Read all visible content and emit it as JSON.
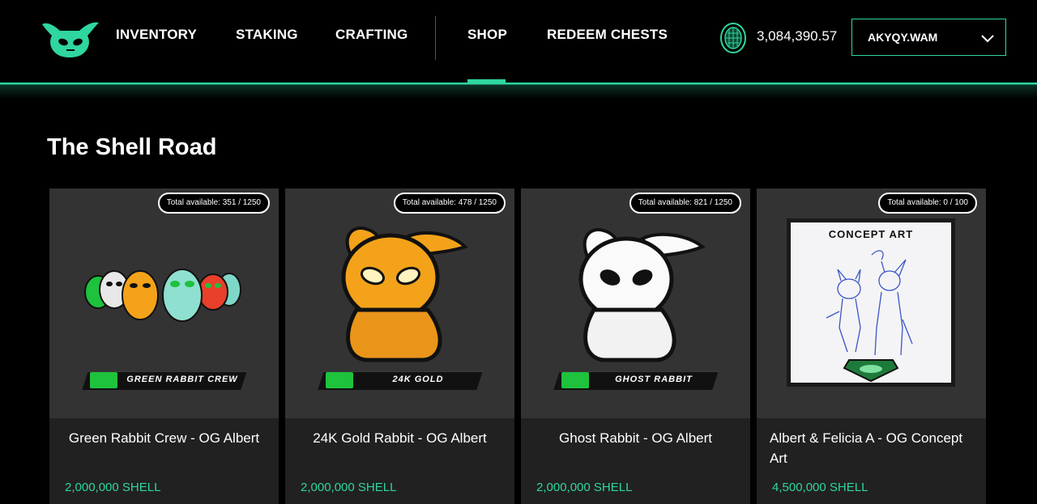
{
  "nav": {
    "items": [
      {
        "label": "INVENTORY",
        "active": false
      },
      {
        "label": "STAKING",
        "active": false
      },
      {
        "label": "CRAFTING",
        "active": false
      },
      {
        "label": "SHOP",
        "active": true
      },
      {
        "label": "REDEEM CHESTS",
        "active": false
      }
    ]
  },
  "wallet": {
    "balance": "3,084,390.57",
    "coin_icon": "shell-coin-icon"
  },
  "account": {
    "name": "AKYQY.WAM"
  },
  "page": {
    "title": "The Shell Road"
  },
  "colors": {
    "accent": "#2fd6a0",
    "card_bg": "#212121",
    "image_bg": "#333333"
  },
  "cards": [
    {
      "available": "Total available: 351 / 1250",
      "banner": "GREEN RABBIT CREW",
      "name": "Green Rabbit Crew - OG Albert",
      "price": "2,000,000 SHELL"
    },
    {
      "available": "Total available: 478 / 1250",
      "banner": "24K GOLD",
      "name": "24K Gold Rabbit - OG Albert",
      "price": "2,000,000 SHELL"
    },
    {
      "available": "Total available: 821 / 1250",
      "banner": "GHOST RABBIT",
      "name": "Ghost Rabbit - OG Albert",
      "price": "2,000,000 SHELL"
    },
    {
      "available": "Total available: 0 / 100",
      "banner_title": "CONCEPT ART",
      "name": "Albert & Felicia A - OG Concept Art",
      "price": "4,500,000 SHELL"
    }
  ]
}
